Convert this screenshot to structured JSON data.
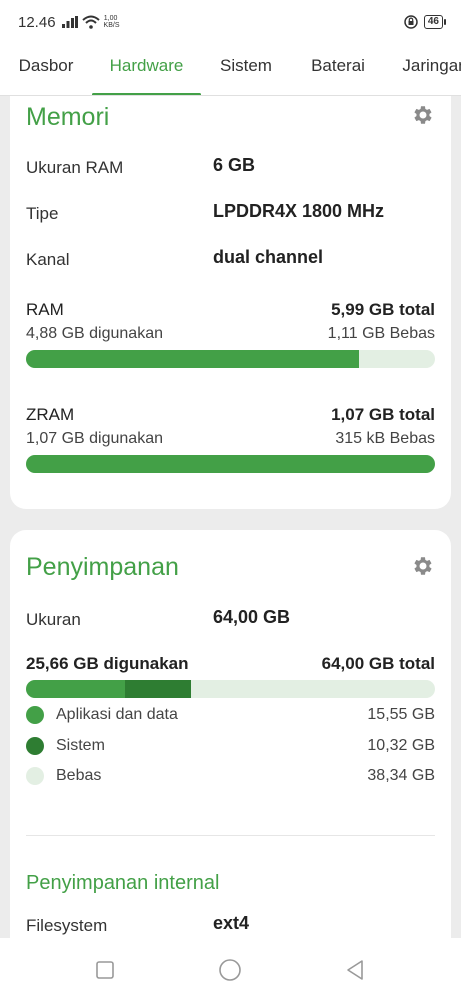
{
  "status_bar": {
    "time": "12.46",
    "speed_value": "1,00",
    "speed_unit": "KB/S",
    "battery": "46"
  },
  "tabs": [
    {
      "label": "Dasbor"
    },
    {
      "label": "Hardware"
    },
    {
      "label": "Sistem"
    },
    {
      "label": "Baterai"
    },
    {
      "label": "Jaringan"
    }
  ],
  "memory": {
    "title": "Memori",
    "ram_size_label": "Ukuran RAM",
    "ram_size_value": "6 GB",
    "type_label": "Tipe",
    "type_value": "LPDDR4X 1800 MHz",
    "channel_label": "Kanal",
    "channel_value": "dual channel",
    "ram": {
      "name": "RAM",
      "total": "5,99 GB total",
      "used": "4,88 GB digunakan",
      "free": "1,11 GB Bebas",
      "used_fraction": 0.815
    },
    "zram": {
      "name": "ZRAM",
      "total": "1,07 GB total",
      "used": "1,07 GB digunakan",
      "free": "315 kB Bebas",
      "used_fraction": 1.0
    }
  },
  "storage": {
    "title": "Penyimpanan",
    "size_label": "Ukuran",
    "size_value": "64,00 GB",
    "used": "25,66 GB digunakan",
    "total": "64,00 GB total",
    "apps_fraction": 0.243,
    "system_fraction": 0.161,
    "legend": [
      {
        "name": "Aplikasi dan data",
        "value": "15,55 GB",
        "color": "#43a047"
      },
      {
        "name": "Sistem",
        "value": "10,32 GB",
        "color": "#2e7d32"
      },
      {
        "name": "Bebas",
        "value": "38,34 GB",
        "color": "#e3efe3"
      }
    ],
    "internal_title": "Penyimpanan internal",
    "filesystem_label": "Filesystem",
    "filesystem_value": "ext4"
  },
  "colors": {
    "accent": "#43a047",
    "accent_dark": "#2e7d32",
    "bar_bg": "#e3efe3"
  }
}
